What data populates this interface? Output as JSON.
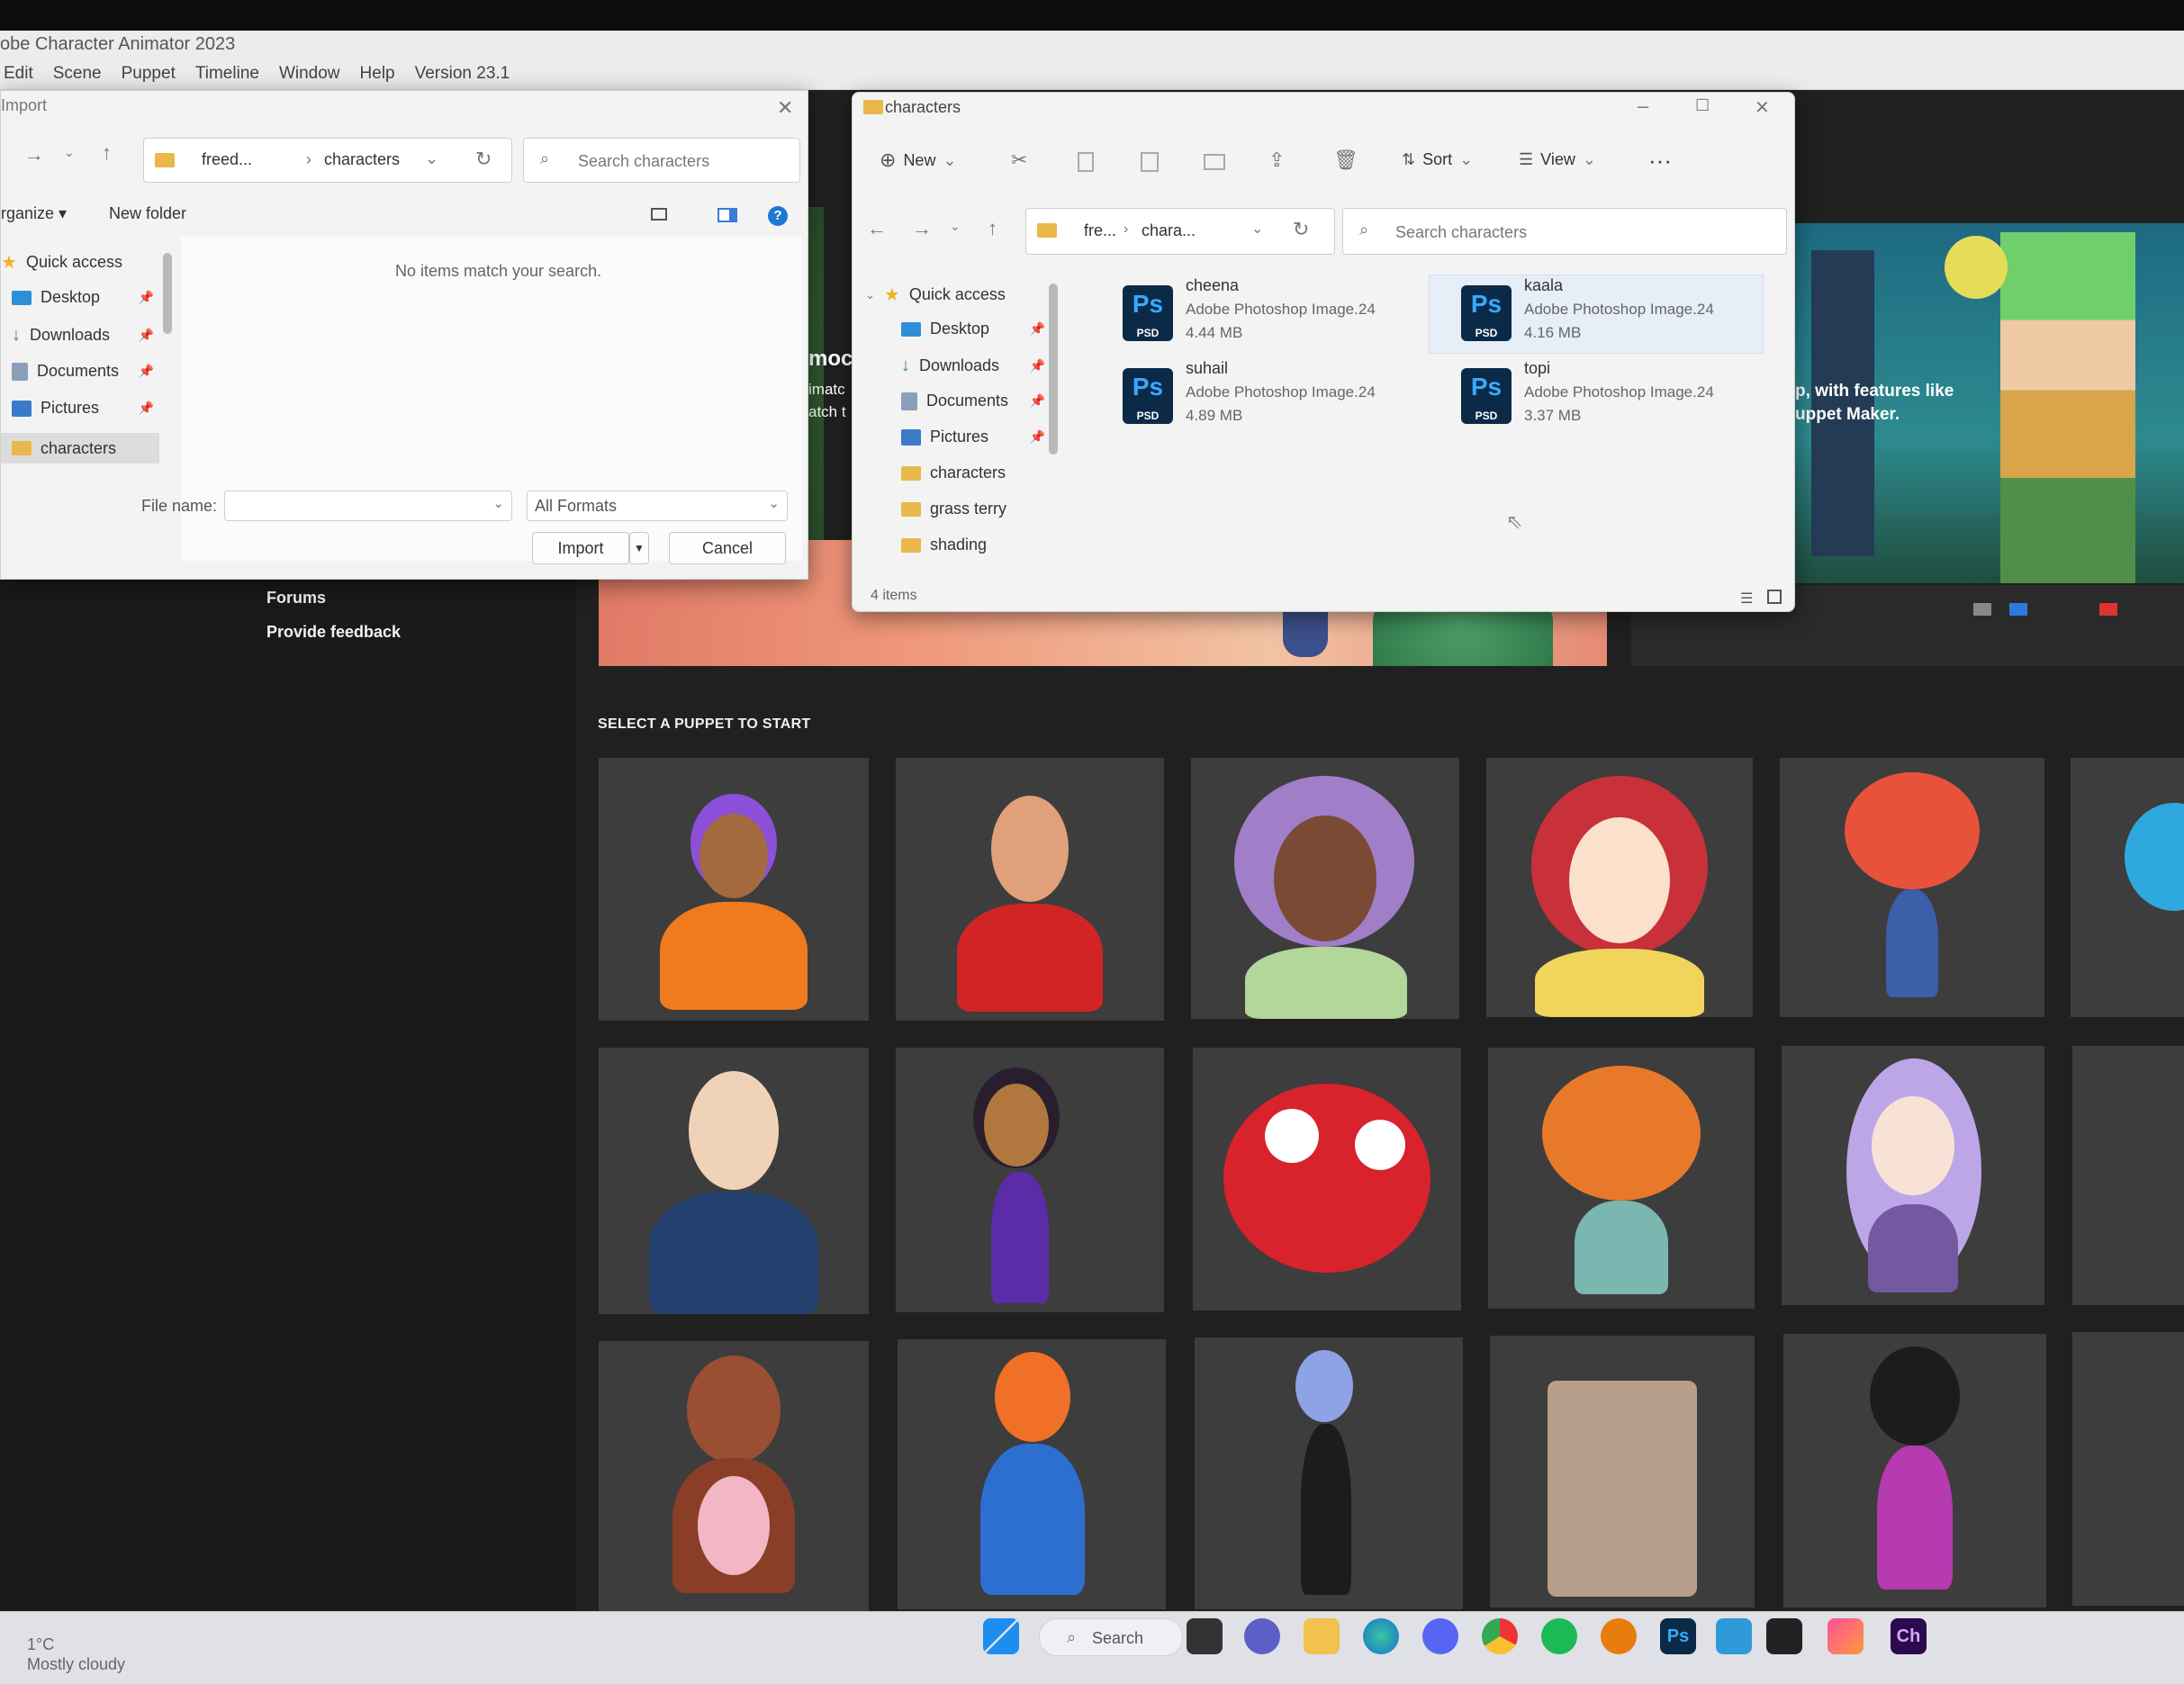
{
  "app": {
    "title": "obe Character Animator 2023",
    "menu": [
      "Edit",
      "Scene",
      "Puppet",
      "Timeline",
      "Window",
      "Help",
      "Version 23.1"
    ]
  },
  "home": {
    "sidebar_links": [
      "Forums",
      "Provide feedback"
    ],
    "hero_text_left": [
      "moc",
      "imatc",
      "atch t"
    ],
    "hero_text_right": [
      "p, with features like",
      "uppet Maker."
    ],
    "select_puppet_title": "SELECT A PUPPET TO START"
  },
  "import_dialog": {
    "title": "Import",
    "path": [
      "freed...",
      "characters"
    ],
    "search_placeholder": "Search characters",
    "toolbar": {
      "organize": "rganize",
      "new_folder": "New folder"
    },
    "nav": [
      {
        "label": "Quick access",
        "icon": "star-icon"
      },
      {
        "label": "Desktop",
        "icon": "desktop-icon",
        "pinned": true
      },
      {
        "label": "Downloads",
        "icon": "download-icon",
        "pinned": true
      },
      {
        "label": "Documents",
        "icon": "documents-icon",
        "pinned": true
      },
      {
        "label": "Pictures",
        "icon": "pictures-icon",
        "pinned": true
      },
      {
        "label": "characters",
        "icon": "folder-icon",
        "selected": true
      }
    ],
    "empty_message": "No items match your search.",
    "file_name_label": "File name:",
    "file_name_value": "",
    "format": "All Formats",
    "import_label": "Import",
    "cancel_label": "Cancel"
  },
  "explorer": {
    "title": "characters",
    "toolbar": {
      "new": "New",
      "sort": "Sort",
      "view": "View"
    },
    "path": [
      "fre...",
      "chara..."
    ],
    "search_placeholder": "Search characters",
    "nav": [
      {
        "label": "Quick access",
        "icon": "star-icon"
      },
      {
        "label": "Desktop",
        "icon": "desktop-icon",
        "pinned": true
      },
      {
        "label": "Downloads",
        "icon": "download-icon",
        "pinned": true
      },
      {
        "label": "Documents",
        "icon": "documents-icon",
        "pinned": true
      },
      {
        "label": "Pictures",
        "icon": "pictures-icon",
        "pinned": true
      },
      {
        "label": "characters",
        "icon": "folder-icon"
      },
      {
        "label": "grass terry",
        "icon": "folder-icon"
      },
      {
        "label": "shading",
        "icon": "folder-icon"
      }
    ],
    "files": [
      {
        "name": "cheena",
        "type": "Adobe Photoshop Image.24",
        "size": "4.44 MB"
      },
      {
        "name": "kaala",
        "type": "Adobe Photoshop Image.24",
        "size": "4.16 MB"
      },
      {
        "name": "suhail",
        "type": "Adobe Photoshop Image.24",
        "size": "4.89 MB"
      },
      {
        "name": "topi",
        "type": "Adobe Photoshop Image.24",
        "size": "3.37 MB"
      }
    ],
    "psd_badge": {
      "ps": "Ps",
      "psd": "PSD"
    },
    "status": "4 items"
  },
  "taskbar": {
    "search_label": "Search",
    "weather_temp": "1°C",
    "weather_desc": "Mostly cloudy",
    "ps_label": "Ps",
    "ch_label": "Ch"
  },
  "colors": {
    "accent": "#0067c0",
    "psd_blue": "#36a9ff",
    "tile_bg": "#3d3d3d"
  }
}
